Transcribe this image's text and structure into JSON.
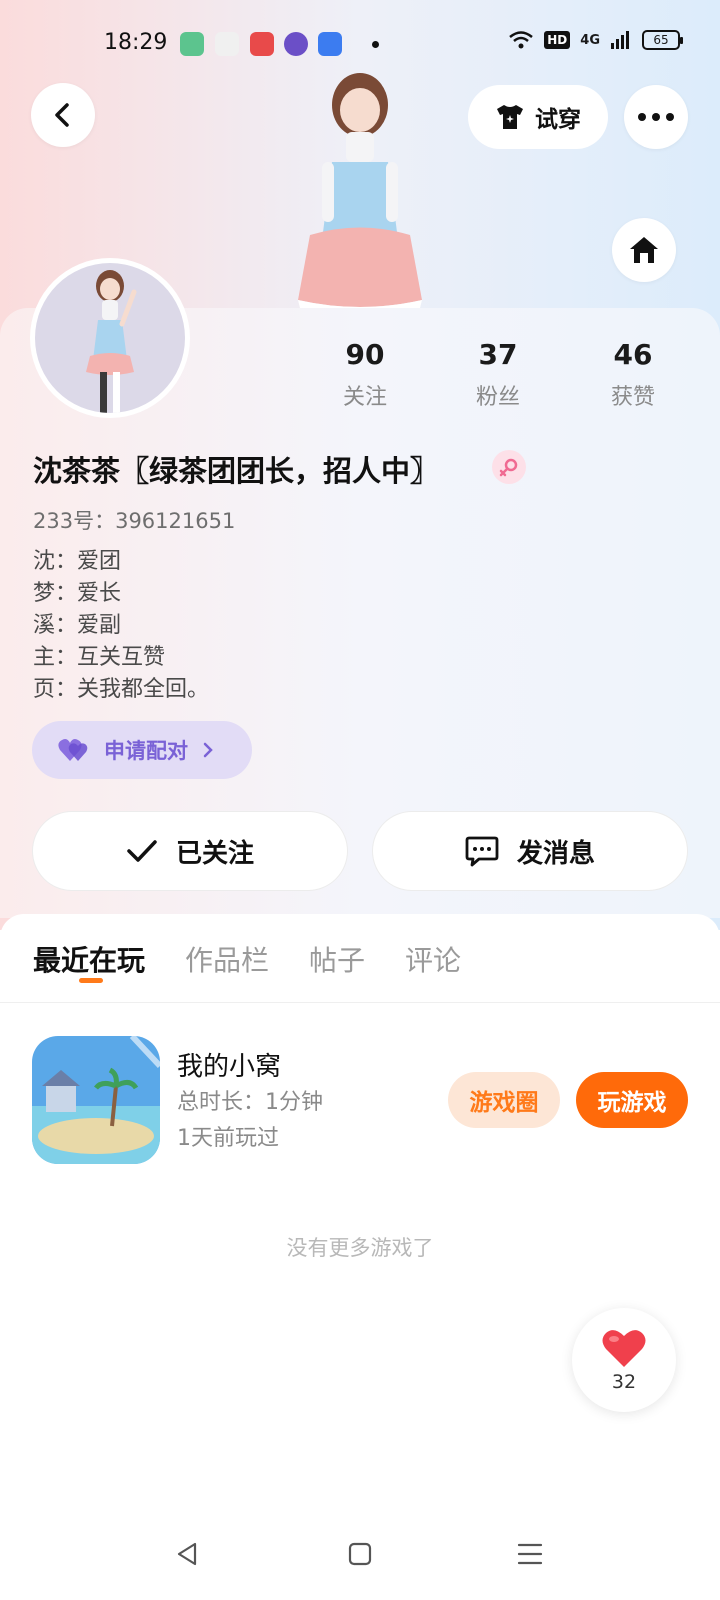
{
  "status_bar": {
    "time": "18:29",
    "network": "4G",
    "hd": "HD",
    "battery": "65"
  },
  "header": {
    "try_on_label": "试穿"
  },
  "stats": [
    {
      "value": "90",
      "label": "关注"
    },
    {
      "value": "37",
      "label": "粉丝"
    },
    {
      "value": "46",
      "label": "获赞"
    }
  ],
  "profile": {
    "nickname": "沈茶茶〖绿茶团团长，招人中〗",
    "user_id": "233号：396121651",
    "bio_lines": [
      "沈：爱团",
      "梦：爱长",
      "溪：爱副",
      "主：互关互赞",
      "页：关我都全回。"
    ],
    "pair_label": "申请配对"
  },
  "actions": {
    "follow_label": "已关注",
    "message_label": "发消息"
  },
  "tabs": [
    "最近在玩",
    "作品栏",
    "帖子",
    "评论"
  ],
  "game": {
    "title": "我的小窝",
    "duration": "总时长：1分钟",
    "last_played": "1天前玩过",
    "circle_label": "游戏圈",
    "play_label": "玩游戏"
  },
  "no_more_text": "没有更多游戏了",
  "like": {
    "count": "32"
  },
  "colors": {
    "accent_orange": "#ff6a0a",
    "pair_purple": "#7a62d6",
    "gender_pink": "#f06a92"
  }
}
